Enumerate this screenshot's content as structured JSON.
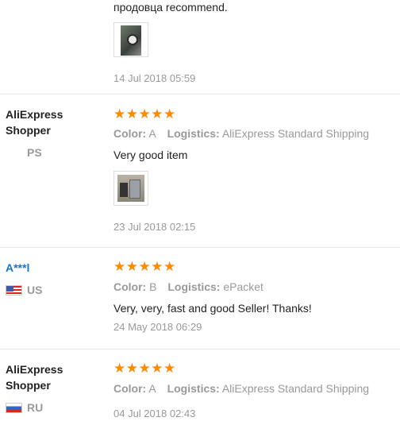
{
  "reviews": [
    {
      "text": "продовца recommend.",
      "has_thumb": true,
      "date": "14 Jul 2018 05:59"
    },
    {
      "buyer_name_line1": "AliExpress",
      "buyer_name_line2": "Shopper",
      "country": "PS",
      "stars": "★★★★★",
      "color_label": "Color:",
      "color_value": "A",
      "logistics_label": "Logistics:",
      "logistics_value": "AliExpress Standard Shipping",
      "text": "Very good item",
      "has_thumb": true,
      "date": "23 Jul 2018 02:15"
    },
    {
      "buyer_name_line1": "A***l",
      "country": "US",
      "stars": "★★★★★",
      "color_label": "Color:",
      "color_value": "B",
      "logistics_label": "Logistics:",
      "logistics_value": "ePacket",
      "text": "Very, very, fast and good Seller! Thanks!",
      "date": "24 May 2018 06:29"
    },
    {
      "buyer_name_line1": "AliExpress",
      "buyer_name_line2": "Shopper",
      "country": "RU",
      "stars": "★★★★★",
      "color_label": "Color:",
      "color_value": "A",
      "logistics_label": "Logistics:",
      "logistics_value": "AliExpress Standard Shipping",
      "date": "04 Jul 2018 02:43"
    }
  ],
  "colors": {
    "star": "#ff8a00",
    "link": "#1a73c4",
    "muted": "#999999",
    "divider": "#e6e6e6"
  }
}
